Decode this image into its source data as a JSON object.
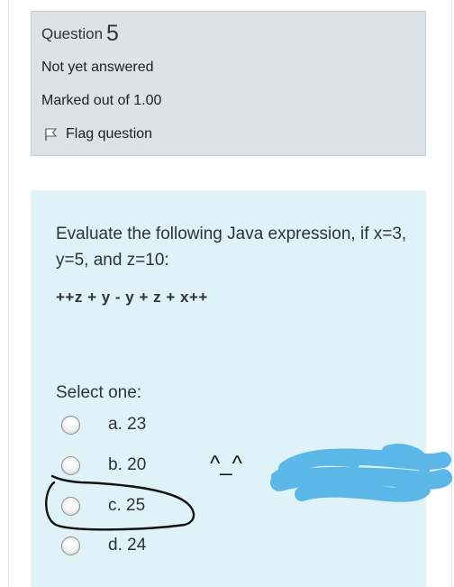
{
  "info": {
    "question_label": "Question",
    "question_number": "5",
    "state": "Not yet answered",
    "grade": "Marked out of 1.00",
    "flag_label": "Flag question"
  },
  "question": {
    "text": "Evaluate the following Java expression, if x=3, y=5, and z=10:",
    "expression": "++z + y - y + z + x++",
    "prompt": "Select one:",
    "answers": [
      {
        "label": "a. 23",
        "selected": false
      },
      {
        "label": "b. 20",
        "selected": false
      },
      {
        "label": "c. 25",
        "selected": false
      },
      {
        "label": "d. 24",
        "selected": false
      }
    ]
  },
  "annotations": {
    "face_text": "^_^",
    "circle_color": "#111111",
    "scribble_color": "#5ab7e8"
  },
  "colors": {
    "info_bg": "#dee2e6",
    "content_bg": "#def2f8"
  }
}
